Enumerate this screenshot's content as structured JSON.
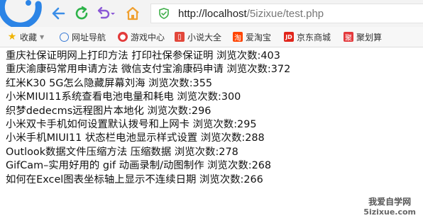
{
  "address_bar": {
    "host": "http://localhost",
    "path": "/5izixue/test.php"
  },
  "bookmarks": [
    {
      "label": "收藏",
      "icon": "star-icon",
      "color": "#f0b400"
    },
    {
      "label": "网址导航",
      "icon": "globe-icon",
      "color": "#3a7bd5"
    },
    {
      "label": "游戏中心",
      "icon": "game-icon",
      "color": "#e23a3a"
    },
    {
      "label": "小说大全",
      "icon": "book-icon",
      "color": "#e2473b"
    },
    {
      "label": "爱淘宝",
      "icon": "taobao-icon",
      "color": "#ff4400"
    },
    {
      "label": "京东商城",
      "icon": "jd-icon",
      "color": "#e1251b"
    },
    {
      "label": "聚划算",
      "icon": "juhuasuan-icon",
      "color": "#e4393c"
    }
  ],
  "articles": [
    {
      "title": "重庆社保证明网上打印方法 打印社保参保证明",
      "views_label": "浏览次数:",
      "views": "403"
    },
    {
      "title": "重庆渝康码常用申请方法 微信支付宝渝康码申请",
      "views_label": "浏览次数:",
      "views": "372"
    },
    {
      "title": "红米K30 5G怎么隐藏屏幕刘海",
      "views_label": "浏览次数:",
      "views": "355"
    },
    {
      "title": "小米MIUI11系统查看电池电量和耗电",
      "views_label": "浏览次数:",
      "views": "300"
    },
    {
      "title": "织梦dedecms远程图片本地化",
      "views_label": "浏览次数:",
      "views": "296"
    },
    {
      "title": "小米双卡手机如何设置默认拨号和上网卡",
      "views_label": "浏览次数:",
      "views": "295"
    },
    {
      "title": "小米手机MIUI11 状态栏电池显示样式设置",
      "views_label": "浏览次数:",
      "views": "288"
    },
    {
      "title": "Outlook数据文件压缩方法 压缩数据",
      "views_label": "浏览次数:",
      "views": "278"
    },
    {
      "title": "GifCam–实用好用的 gif 动画录制/动图制作",
      "views_label": "浏览次数:",
      "views": "268"
    },
    {
      "title": "如何在Excel图表坐标轴上显示不连续日期",
      "views_label": "浏览次数:",
      "views": "266"
    }
  ],
  "watermark": {
    "line1": "我爱自学网",
    "line2": "5izixue.com"
  },
  "colors": {
    "back_arrow": "#3b8ee8",
    "refresh": "#2eb34a",
    "undo": "#8a57d6",
    "home": "#f0a030",
    "secure_shield": "#3fae49",
    "logo": "#2b84e6"
  }
}
